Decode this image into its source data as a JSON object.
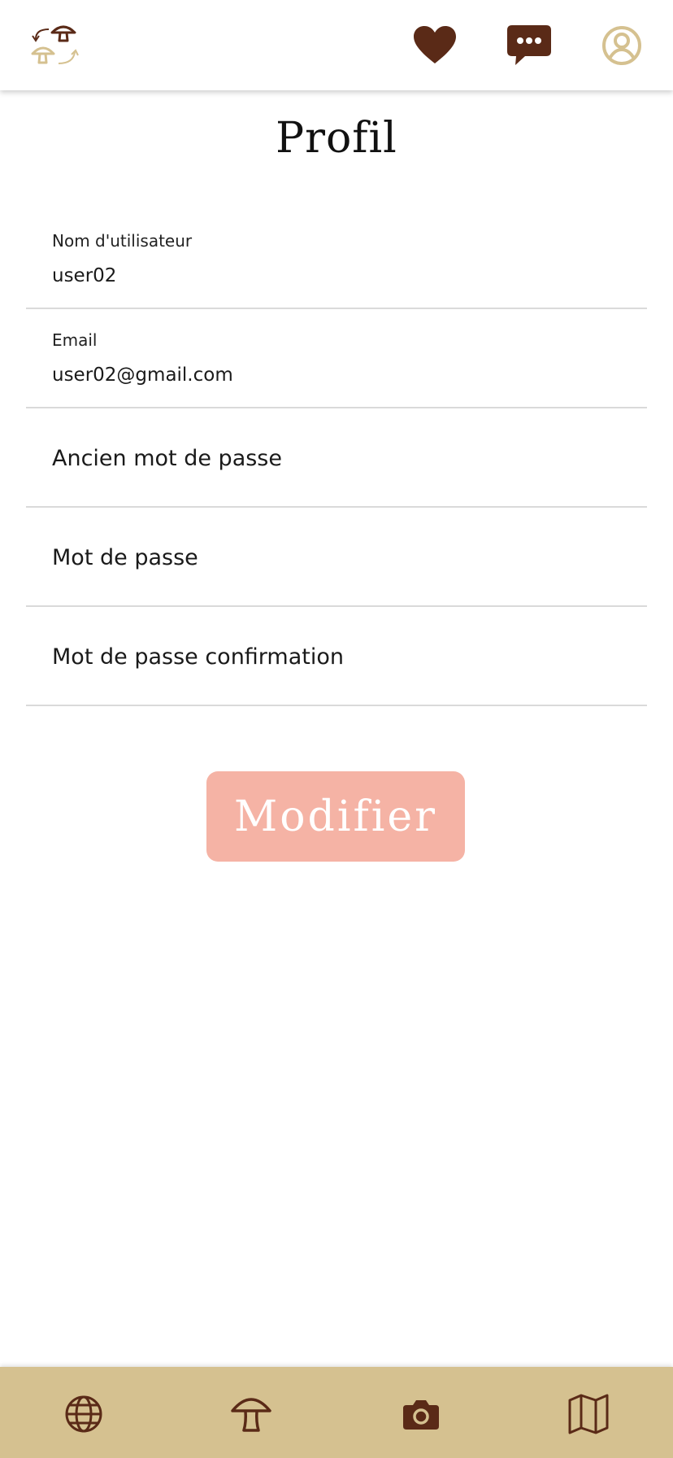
{
  "header": {
    "logo_icon": "mushroom-swap-logo",
    "favorites_icon": "heart-icon",
    "messages_icon": "chat-bubble-icon",
    "account_icon": "user-circle-icon"
  },
  "page": {
    "title": "Profil"
  },
  "form": {
    "username": {
      "label": "Nom d'utilisateur",
      "value": "user02"
    },
    "email": {
      "label": "Email",
      "value": "user02@gmail.com"
    },
    "old_password": {
      "placeholder": "Ancien mot de passe"
    },
    "new_password": {
      "placeholder": "Mot de passe"
    },
    "confirm_password": {
      "placeholder": "Mot de passe confirmation"
    },
    "submit_label": "Modifier"
  },
  "bottom_nav": {
    "items": [
      {
        "icon": "globe-icon"
      },
      {
        "icon": "mushroom-icon"
      },
      {
        "icon": "camera-icon"
      },
      {
        "icon": "map-icon"
      }
    ]
  },
  "colors": {
    "brown": "#5a2a17",
    "tan": "#d5c190",
    "button": "#f5b3a5",
    "divider": "#dadada"
  }
}
